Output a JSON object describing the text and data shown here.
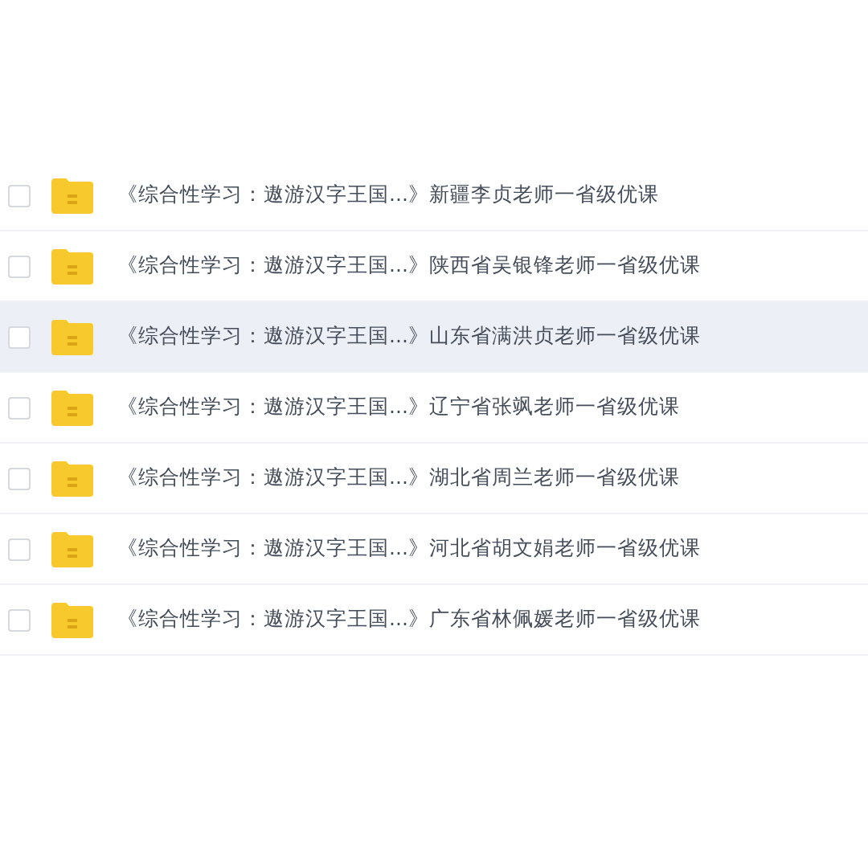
{
  "files": [
    {
      "name": "《综合性学习：遨游汉字王国...》新疆李贞老师一省级优课",
      "checked": false,
      "highlighted": false
    },
    {
      "name": "《综合性学习：遨游汉字王国...》陕西省吴银锋老师一省级优课",
      "checked": false,
      "highlighted": false
    },
    {
      "name": "《综合性学习：遨游汉字王国...》山东省满洪贞老师一省级优课",
      "checked": false,
      "highlighted": true
    },
    {
      "name": "《综合性学习：遨游汉字王国...》辽宁省张飒老师一省级优课",
      "checked": false,
      "highlighted": false
    },
    {
      "name": "《综合性学习：遨游汉字王国...》湖北省周兰老师一省级优课",
      "checked": false,
      "highlighted": false
    },
    {
      "name": "《综合性学习：遨游汉字王国...》河北省胡文娟老师一省级优课",
      "checked": false,
      "highlighted": false
    },
    {
      "name": "《综合性学习：遨游汉字王国...》广东省林佩媛老师一省级优课",
      "checked": false,
      "highlighted": false
    }
  ]
}
